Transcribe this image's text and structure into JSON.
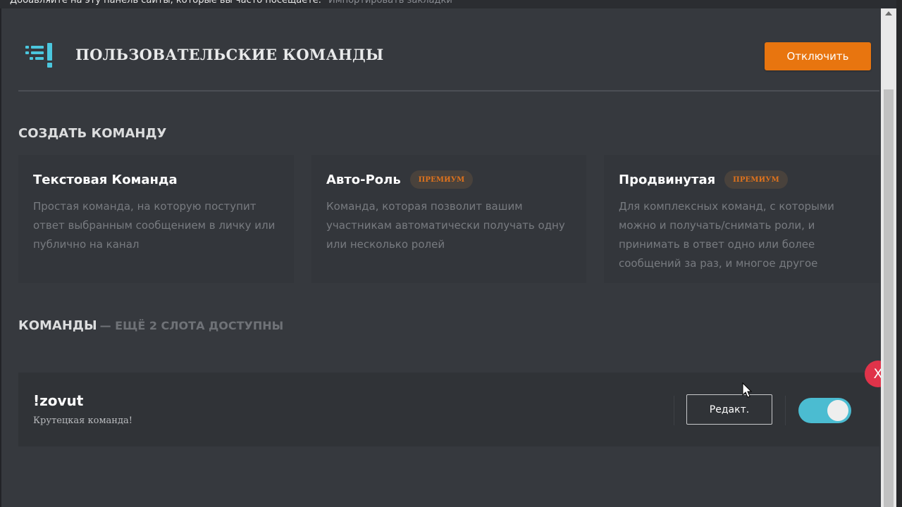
{
  "browser": {
    "bookmark_hint": "Добавляйте на эту панель сайты, которые вы часто посещаете.",
    "import_link": "Импортировать закладки"
  },
  "header": {
    "title": "ПОЛЬЗОВАТЕЛЬСКИЕ КОМАНДЫ",
    "disable_label": "Отключить",
    "icon": "custom-commands-icon"
  },
  "create": {
    "section_title": "СОЗДАТЬ КОМАНДУ",
    "cards": [
      {
        "title": "Текстовая Команда",
        "badge": "",
        "description": "Простая команда, на которую поступит ответ выбранным сообщением в личку или публично на канал"
      },
      {
        "title": "Авто-Роль",
        "badge": "ПРЕМИУМ",
        "description": "Команда, которая позволит вашим участникам автоматически получать одну или несколько ролей"
      },
      {
        "title": "Продвинутая",
        "badge": "ПРЕМИУМ",
        "description": "Для комплексных команд, с которыми можно и получать/снимать роли, и принимать в ответ одно или более сообщений за раз, и многое другое"
      }
    ]
  },
  "commands": {
    "title": "КОМАНДЫ",
    "subtitle": "— ЕЩЁ 2 СЛОТА ДОСТУПНЫ",
    "items": [
      {
        "name": "!zovut",
        "description": "Крутецкая команда!",
        "edit_label": "Редакт.",
        "enabled": true
      }
    ]
  },
  "close_label": "X",
  "colors": {
    "background": "#36393e",
    "accent_orange": "#e8750f",
    "toggle_on": "#4bbcd1",
    "close_red": "#e0334a",
    "premium_text": "#e0731d"
  }
}
